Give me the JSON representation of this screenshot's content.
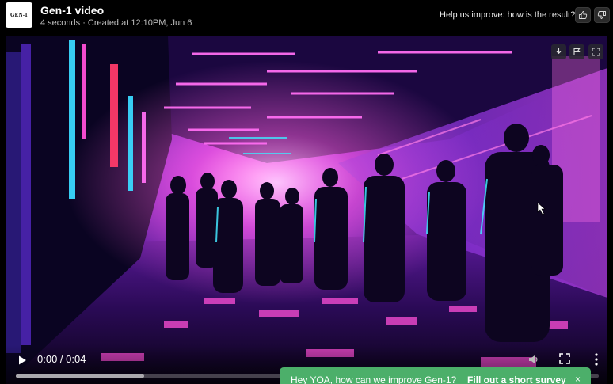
{
  "header": {
    "logo_text": "GEN-1",
    "title": "Gen-1 video",
    "subtitle": "4 seconds · Created at 12:10PM, Jun 6",
    "feedback_prompt": "Help us improve: how is the result?",
    "icons": [
      "thumbs-up-icon",
      "thumbs-down-icon"
    ]
  },
  "video_overlay": {
    "icons": [
      "download-icon",
      "flag-icon",
      "expand-icon"
    ]
  },
  "player": {
    "time": "0:00 / 0:04",
    "buffered_fraction": 0.22,
    "icons": [
      "play-icon",
      "volume-icon",
      "fullscreen-icon",
      "more-vert-icon"
    ]
  },
  "survey_toast": {
    "message": "Hey YOA, how can we improve Gen-1?",
    "link_label": "Fill out a short survey",
    "close_label": "×",
    "color": "#4caf6a"
  },
  "colors": {
    "header_bg": "#000000",
    "neon_pink": "#ff4fd8",
    "neon_cyan": "#37e0ff",
    "neon_purple": "#7b2ff7"
  }
}
